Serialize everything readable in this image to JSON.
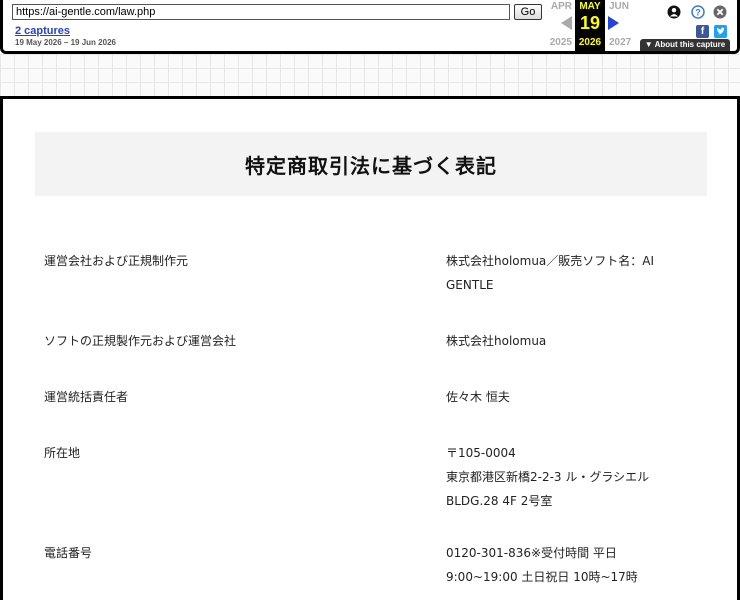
{
  "wayback": {
    "url": "https://ai-gentle.com/law.php",
    "go_label": "Go",
    "captures_label": "2 captures",
    "date_range": "19 May 2026 – 19 Jun 2026",
    "prev": {
      "month": "APR",
      "year": "2025"
    },
    "current": {
      "month": "MAY",
      "day": "19",
      "year": "2026"
    },
    "next": {
      "month": "JUN",
      "year": "2027"
    },
    "about_label": "▼ About this capture",
    "icons": [
      "user-icon",
      "help-icon",
      "close-icon",
      "facebook-icon",
      "twitter-icon"
    ],
    "colors": {
      "accent": "#ffff00",
      "link": "#2244cc",
      "next_arrow": "#2244dd"
    }
  },
  "page": {
    "title": "特定商取引法に基づく表記",
    "rows": [
      {
        "label": "運営会社および正規制作元",
        "lines": [
          "株式会社holomua／販売ソフト名：AI",
          "GENTLE"
        ]
      },
      {
        "label": "ソフトの正規製作元および運営会社",
        "lines": [
          "株式会社holomua"
        ]
      },
      {
        "label": "運営統括責任者",
        "lines": [
          "佐々木 恒夫"
        ]
      },
      {
        "label": "所在地",
        "lines": [
          "〒105-0004",
          "東京都港区新橋2-2-3 ル・グラシエル",
          "BLDG.28 4F 2号室"
        ]
      },
      {
        "label": "電話番号",
        "lines": [
          "0120-301-836※受付時間 平日",
          "9:00~19:00 土日祝日 10時~17時"
        ]
      }
    ]
  }
}
